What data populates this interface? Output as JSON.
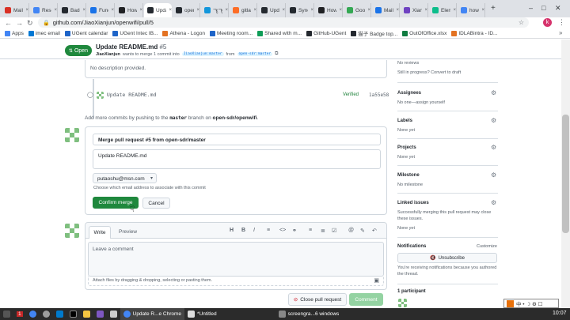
{
  "browser": {
    "tabs": [
      {
        "label": "Mail -",
        "color": "#d93025"
      },
      {
        "label": "Resour",
        "color": "#4285f4"
      },
      {
        "label": "Badge",
        "color": "#24292f"
      },
      {
        "label": "Funding",
        "color": "#1a73e8"
      },
      {
        "label": "How t",
        "color": "#202124"
      },
      {
        "label": "Upda",
        "color": "#24292f",
        "active": true
      },
      {
        "label": "openw",
        "color": "#24292f"
      },
      {
        "label": "飞飞飞",
        "color": "#1296db"
      },
      {
        "label": "gitlab",
        "color": "#fc6d26"
      },
      {
        "label": "Update",
        "color": "#24292f"
      },
      {
        "label": "Synch",
        "color": "#24292f"
      },
      {
        "label": "How t",
        "color": "#202124"
      },
      {
        "label": "Google",
        "color": "#34a853"
      },
      {
        "label": "Mail -",
        "color": "#1a73e8"
      },
      {
        "label": "Xiang",
        "color": "#6f42c1"
      },
      {
        "label": "Element",
        "color": "#0dbd8b"
      },
      {
        "label": "how t",
        "color": "#4285f4"
      }
    ],
    "new_tab": "+",
    "url": "github.com/JiaoXianjun/openwifi/pull/5",
    "profile_initial": "k",
    "bookmarks": [
      {
        "label": "Apps",
        "color": "#4285f4"
      },
      {
        "label": "imec email",
        "color": "#0078d4"
      },
      {
        "label": "UGent calendar",
        "color": "#1e64c8"
      },
      {
        "label": "UGent Intec IB...",
        "color": "#1e64c8"
      },
      {
        "label": "Athena - Logon",
        "color": "#e37222"
      },
      {
        "label": "Meeting room...",
        "color": "#1e64c8"
      },
      {
        "label": "Shared with m...",
        "color": "#0f9d58"
      },
      {
        "label": "GitHub-UGent",
        "color": "#24292f"
      },
      {
        "label": "猫子 Badge top...",
        "color": "#24292f"
      },
      {
        "label": "OutOfOffice.xlsx",
        "color": "#107c41"
      },
      {
        "label": "IDLABintra - ID...",
        "color": "#e37222"
      }
    ],
    "more_bookmarks": "»"
  },
  "pr": {
    "status": "Open",
    "title": "Update README.md",
    "number": "#5",
    "author": "JiaoXianjun",
    "subtitle_mid": "wants to merge 1 commit into",
    "base_branch": "JiaoXianjun:master",
    "from_word": "from",
    "head_branch": "open-sdr:master"
  },
  "timeline": {
    "no_description": "No description provided.",
    "commit_message": "Update README.md",
    "verified": "Verified",
    "sha": "1a55e58",
    "add_commits_pre": "Add more commits by pushing to the",
    "add_commits_branch": "master",
    "add_commits_mid": "branch on",
    "add_commits_repo": "open-sdr/openwifi",
    "add_commits_end": "."
  },
  "merge": {
    "commit_title": "Merge pull request #5 from open-sdr/master",
    "commit_body": "Update README.md",
    "email": "putaoshu@msn.com",
    "email_help": "Choose which email address to associate with this commit",
    "confirm_label": "Confirm merge",
    "cancel_label": "Cancel"
  },
  "comment": {
    "tab_write": "Write",
    "tab_preview": "Preview",
    "placeholder": "Leave a comment",
    "attach_hint": "Attach files by dragging & dropping, selecting or pasting them.",
    "close_label": "Close pull request",
    "comment_label": "Comment"
  },
  "sidebar": {
    "no_reviews": "No reviews",
    "draft_hint": "Still in progress? Convert to draft",
    "assignees_title": "Assignees",
    "assignees_text": "No one—assign yourself",
    "labels_title": "Labels",
    "labels_text": "None yet",
    "projects_title": "Projects",
    "projects_text": "None yet",
    "milestone_title": "Milestone",
    "milestone_text": "No milestone",
    "linked_title": "Linked issues",
    "linked_desc": "Successfully merging this pull request may close these issues.",
    "linked_text": "None yet",
    "notif_title": "Notifications",
    "customize": "Customize",
    "unsubscribe": "Unsubscribe",
    "notif_desc": "You're receiving notifications because you authored the thread.",
    "participants": "1 participant"
  },
  "taskbar": {
    "badge": "1",
    "chrome_label": "Update R...e Chrome",
    "editor_label": "*Untitled",
    "screen_label": "screengra...6 windows",
    "clock": "10:07",
    "tray_chars": "中 • ☽ ⚙ ☐"
  },
  "colors": {
    "accent_green": "#1f883d",
    "link_blue": "#0969da"
  }
}
